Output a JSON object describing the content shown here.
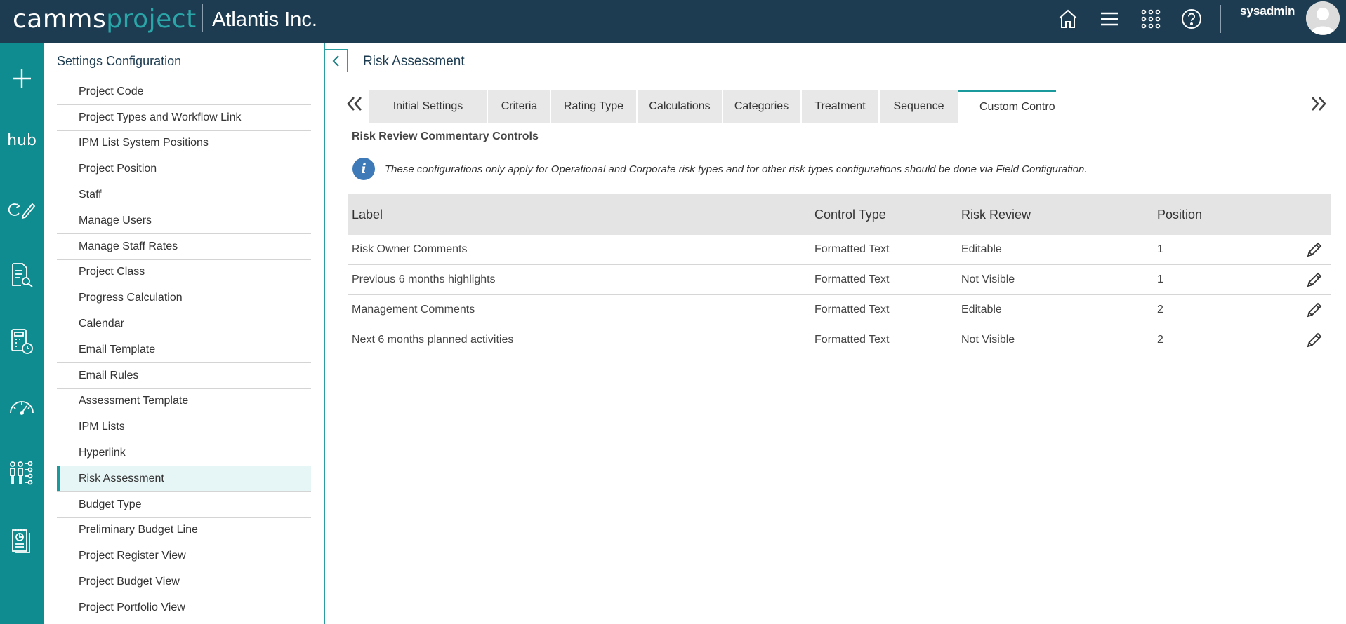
{
  "header": {
    "brand_part1": "camms",
    "brand_part2": "project",
    "company": "Atlantis Inc.",
    "icons": [
      "home-icon",
      "menu-icon",
      "apps-grid-icon",
      "help-icon"
    ],
    "username": "sysadmin"
  },
  "rail": {
    "items": [
      "add-icon",
      "hub",
      "refresh-edit-icon",
      "document-search-icon",
      "calculator-clock-icon",
      "gauge-icon",
      "people-settings-icon",
      "report-icon"
    ],
    "hub_label": "hub"
  },
  "settings": {
    "title": "Settings Configuration",
    "items": [
      {
        "label": "Project Code"
      },
      {
        "label": "Project Types and Workflow Link"
      },
      {
        "label": "IPM List System Positions"
      },
      {
        "label": "Project Position"
      },
      {
        "label": "Staff"
      },
      {
        "label": "Manage Users"
      },
      {
        "label": "Manage Staff Rates"
      },
      {
        "label": "Project Class"
      },
      {
        "label": "Progress Calculation"
      },
      {
        "label": "Calendar"
      },
      {
        "label": "Email Template"
      },
      {
        "label": "Email Rules"
      },
      {
        "label": "Assessment Template"
      },
      {
        "label": "IPM Lists"
      },
      {
        "label": "Hyperlink"
      },
      {
        "label": "Risk Assessment",
        "active": true
      },
      {
        "label": "Budget Type"
      },
      {
        "label": "Preliminary Budget Line"
      },
      {
        "label": "Project Register View"
      },
      {
        "label": "Project Budget View"
      },
      {
        "label": "Project Portfolio View"
      }
    ]
  },
  "main": {
    "title": "Risk Assessment",
    "tabs": [
      {
        "label": "Initial Settings"
      },
      {
        "label": "Criteria"
      },
      {
        "label": "Rating Type"
      },
      {
        "label": "Calculations"
      },
      {
        "label": "Categories"
      },
      {
        "label": "Treatment"
      },
      {
        "label": "Sequence"
      },
      {
        "label": "Custom Contro",
        "active": true
      }
    ],
    "section_title": "Risk Review Commentary Controls",
    "info_text": "These configurations only apply for Operational and Corporate risk types and for other risk types configurations should be done via Field Configuration.",
    "table": {
      "columns": [
        "Label",
        "Control Type",
        "Risk Review",
        "Position"
      ],
      "rows": [
        {
          "label": "Risk Owner Comments",
          "control_type": "Formatted Text",
          "risk_review": "Editable",
          "position": "1"
        },
        {
          "label": "Previous 6 months highlights",
          "control_type": "Formatted Text",
          "risk_review": "Not Visible",
          "position": "1"
        },
        {
          "label": "Management Comments",
          "control_type": "Formatted Text",
          "risk_review": "Editable",
          "position": "2"
        },
        {
          "label": "Next 6 months planned activities",
          "control_type": "Formatted Text",
          "risk_review": "Not Visible",
          "position": "2"
        }
      ]
    }
  },
  "colors": {
    "header_bg": "#1d3c52",
    "rail_bg": "#0f8c8f",
    "accent": "#1a9a9c",
    "brand_accent": "#2aa6a8",
    "info_icon": "#3e7ab8"
  }
}
